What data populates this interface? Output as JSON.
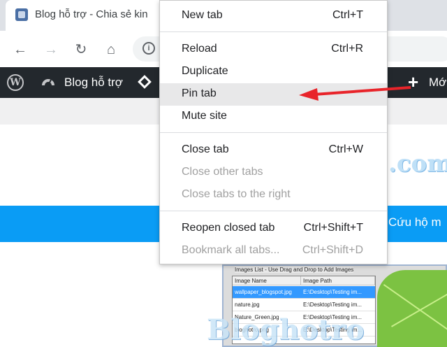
{
  "browser": {
    "tab": {
      "title": "Blog hỗ trợ - Chia sẻ kin"
    },
    "toolbar": {
      "back_icon": "←",
      "forward_icon": "→",
      "reload_icon": "↻",
      "home_icon": "⌂",
      "info_icon": "i"
    }
  },
  "admin_bar": {
    "wp_logo": "W",
    "site_name": "Blog hỗ trợ",
    "new_label": "Mới",
    "plus_icon": "+"
  },
  "context_menu": {
    "items": [
      {
        "label": "New tab",
        "shortcut": "Ctrl+T",
        "enabled": true
      },
      {
        "label": "Reload",
        "shortcut": "Ctrl+R",
        "enabled": true
      },
      {
        "label": "Duplicate",
        "shortcut": "",
        "enabled": true
      },
      {
        "label": "Pin tab",
        "shortcut": "",
        "enabled": true,
        "highlighted": true
      },
      {
        "label": "Mute site",
        "shortcut": "",
        "enabled": true
      },
      {
        "label": "Close tab",
        "shortcut": "Ctrl+W",
        "enabled": true
      },
      {
        "label": "Close other tabs",
        "shortcut": "",
        "enabled": false
      },
      {
        "label": "Close tabs to the right",
        "shortcut": "",
        "enabled": false
      },
      {
        "label": "Reopen closed tab",
        "shortcut": "Ctrl+Shift+T",
        "enabled": true
      },
      {
        "label": "Bookmark all tabs...",
        "shortcut": "Ctrl+Shift+D",
        "enabled": false
      }
    ]
  },
  "page": {
    "watermark_top": ".com",
    "blue_banner_text": "Cứu hộ m",
    "watermark_bottom": "Bloghotro"
  },
  "embedded_screenshot": {
    "title": "Images List - Use Drag and Drop to Add Images",
    "columns": [
      "Image Name",
      "Image Path"
    ],
    "rows": [
      {
        "name": "wallpaper_blogspot.jpg",
        "path": "E:\\Desktop\\Testing im...",
        "selected": true
      },
      {
        "name": "nature.jpg",
        "path": "E:\\Desktop\\Testing im...",
        "selected": false
      },
      {
        "name": "Nature_Green.jpg",
        "path": "E:\\Desktop\\Testing im...",
        "selected": false
      },
      {
        "name": "bloghotro.png",
        "path": "E:\\Desktop\\Testing im...",
        "selected": false
      }
    ]
  },
  "annotation": {
    "arrow_color": "#e8242a"
  },
  "colors": {
    "admin_bar": "#23282d",
    "banner": "#0a9cf5",
    "menu_highlight": "#e8e8e9"
  }
}
